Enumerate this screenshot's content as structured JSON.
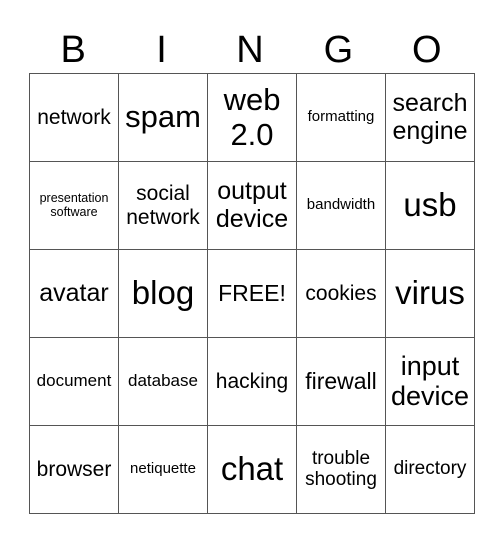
{
  "title_letters": [
    "B",
    "I",
    "N",
    "G",
    "O"
  ],
  "rows": [
    [
      {
        "text": "network",
        "lines": [
          "network"
        ]
      },
      {
        "text": "spam",
        "lines": [
          "spam"
        ]
      },
      {
        "text": "web 2.0",
        "lines": [
          "web",
          "2.0"
        ]
      },
      {
        "text": "formatting",
        "lines": [
          "formatting"
        ]
      },
      {
        "text": "search engine",
        "lines": [
          "search",
          "engine"
        ]
      }
    ],
    [
      {
        "text": "presentation software",
        "lines": [
          "presentation",
          "software"
        ]
      },
      {
        "text": "social network",
        "lines": [
          "social",
          "network"
        ]
      },
      {
        "text": "output device",
        "lines": [
          "output",
          "device"
        ]
      },
      {
        "text": "bandwidth",
        "lines": [
          "bandwidth"
        ]
      },
      {
        "text": "usb",
        "lines": [
          "usb"
        ]
      }
    ],
    [
      {
        "text": "avatar",
        "lines": [
          "avatar"
        ]
      },
      {
        "text": "blog",
        "lines": [
          "blog"
        ]
      },
      {
        "text": "FREE!",
        "lines": [
          "FREE!"
        ]
      },
      {
        "text": "cookies",
        "lines": [
          "cookies"
        ]
      },
      {
        "text": "virus",
        "lines": [
          "virus"
        ]
      }
    ],
    [
      {
        "text": "document",
        "lines": [
          "document"
        ]
      },
      {
        "text": "database",
        "lines": [
          "database"
        ]
      },
      {
        "text": "hacking",
        "lines": [
          "hacking"
        ]
      },
      {
        "text": "firewall",
        "lines": [
          "firewall"
        ]
      },
      {
        "text": "input device",
        "lines": [
          "input",
          "device"
        ]
      }
    ],
    [
      {
        "text": "browser",
        "lines": [
          "browser"
        ]
      },
      {
        "text": "netiquette",
        "lines": [
          "netiquette"
        ]
      },
      {
        "text": "chat",
        "lines": [
          "chat"
        ]
      },
      {
        "text": "trouble shooting",
        "lines": [
          "trouble",
          "shooting"
        ]
      },
      {
        "text": "directory",
        "lines": [
          "directory"
        ]
      }
    ]
  ]
}
